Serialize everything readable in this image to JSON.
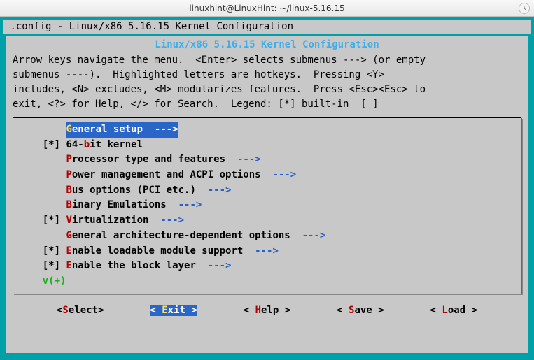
{
  "window": {
    "title": "linuxhint@LinuxHint: ~/linux-5.16.15"
  },
  "header": {
    "dot": ".",
    "text": "config - Linux/x86 5.16.15 Kernel Configuration"
  },
  "panel": {
    "title": "Linux/x86 5.16.15 Kernel Configuration",
    "help": "Arrow keys navigate the menu.  <Enter> selects submenus ---> (or empty\nsubmenus ----).  Highlighted letters are hotkeys.  Pressing <Y>\nincludes, <N> excludes, <M> modularizes features.  Press <Esc><Esc> to\nexit, <?> for Help, </> for Search.  Legend: [*] built-in  [ ]"
  },
  "menu": {
    "items": [
      {
        "prefix": "        ",
        "hot": "G",
        "rest": "eneral setup  ",
        "arrow": "--->",
        "selected": true
      },
      {
        "prefix": "    [*] ",
        "pre": "64-",
        "hot": "b",
        "rest": "it kernel",
        "arrow": ""
      },
      {
        "prefix": "        ",
        "hot": "P",
        "rest": "rocessor type and features  ",
        "arrow": "--->"
      },
      {
        "prefix": "        ",
        "hot": "P",
        "rest": "ower management and ACPI options  ",
        "arrow": "--->"
      },
      {
        "prefix": "        ",
        "hot": "B",
        "rest": "us options (PCI etc.)  ",
        "arrow": "--->"
      },
      {
        "prefix": "        ",
        "hot": "B",
        "rest": "inary Emulations  ",
        "arrow": "--->"
      },
      {
        "prefix": "    [*] ",
        "hot": "V",
        "rest": "irtualization  ",
        "arrow": "--->"
      },
      {
        "prefix": "        ",
        "hot": "G",
        "rest": "eneral architecture-dependent options  ",
        "arrow": "--->"
      },
      {
        "prefix": "    [*] ",
        "hot": "E",
        "rest": "nable loadable module support  ",
        "arrow": "--->"
      },
      {
        "prefix": "    [*] ",
        "hot": "E",
        "rest": "nable the block layer  ",
        "arrow": "--->"
      }
    ],
    "scroll_indicator": "    v(+)"
  },
  "buttons": {
    "select": {
      "open": "<",
      "hot": "S",
      "rest": "elect>",
      "selected": false
    },
    "exit": {
      "open": "< ",
      "hot": "E",
      "rest": "xit > ",
      "selected": true
    },
    "help": {
      "open": "< ",
      "hot": "H",
      "rest": "elp > ",
      "selected": false
    },
    "save": {
      "open": "< ",
      "hot": "S",
      "rest": "ave > ",
      "selected": false
    },
    "load": {
      "open": "< ",
      "hot": "L",
      "rest": "oad > ",
      "selected": false
    }
  }
}
